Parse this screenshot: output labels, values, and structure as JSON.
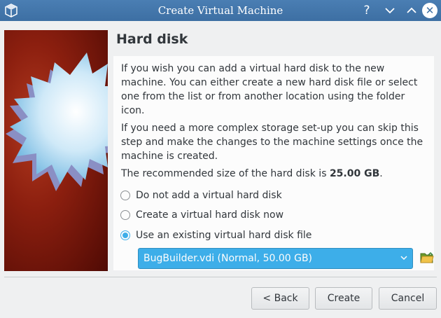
{
  "window": {
    "title": "Create Virtual Machine",
    "help_glyph": "?",
    "minimize_glyph": "⌄",
    "maximize_glyph": "⌃",
    "close_glyph": "✕",
    "app_icon": "virtualbox-icon"
  },
  "page": {
    "heading": "Hard disk",
    "paragraph1": "If you wish you can add a virtual hard disk to the new machine. You can either create a new hard disk file or select one from the list or from another location using the folder icon.",
    "paragraph2": "If you need a more complex storage set-up you can skip this step and make the changes to the machine settings once the machine is created.",
    "recommended_prefix": "The recommended size of the hard disk is ",
    "recommended_size": "25.00 GB",
    "recommended_suffix": "."
  },
  "options": [
    {
      "label": "Do not add a virtual hard disk",
      "checked": false
    },
    {
      "label": "Create a virtual hard disk now",
      "checked": false
    },
    {
      "label": "Use an existing virtual hard disk file",
      "checked": true
    }
  ],
  "disk_select": {
    "selected": "BugBuilder.vdi (Normal, 50.00 GB)",
    "folder_icon": "folder-open-icon"
  },
  "buttons": {
    "back": "< Back",
    "create": "Create",
    "cancel": "Cancel"
  },
  "colors": {
    "accent": "#3daee9",
    "titlebar": "#3d6fa3",
    "side_panel": "#8c1f0f"
  }
}
